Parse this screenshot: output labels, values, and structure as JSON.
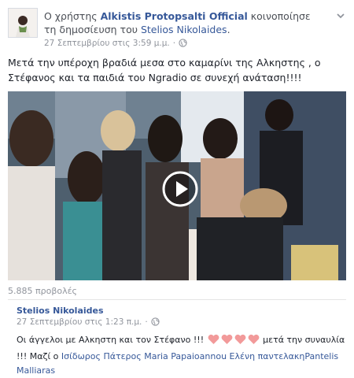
{
  "header": {
    "prefix": "Ο χρήστης ",
    "author": "Alkistis Protopsalti Official",
    "middle": " κοινοποίησε τη δημοσίευση του ",
    "shared_from": "Stelios Nikolaides",
    "suffix": ".",
    "timestamp": "27 Σεπτεμβρίου στις 3:59 μ.μ.",
    "separator": "·",
    "privacy_icon": "globe-icon",
    "options_icon": "chevron-down-icon"
  },
  "post": {
    "text": "Μετά την υπέροχη βραδιά μεσα στο καμαρίνι της Αλκηστης , ο Στέφανος και τα παιδιά του Ngradio σε συνεχή ανάταση!!!!",
    "video": {
      "play_icon": "play-icon"
    },
    "views": "5.885 προβολές"
  },
  "shared": {
    "author": "Stelios Nikolaides",
    "timestamp": "27 Σεπτεμβρίου στις 1:23 π.μ.",
    "separator": "·",
    "privacy_icon": "globe-icon",
    "text_before": "Οι άγγελοι με Αλκηστη και τον Στέφανο !!! ",
    "text_after": " μετά την συναυλία !!! Μαζί ο ",
    "tags": [
      "Ισίδωρος Πάτερος",
      "Maria Papaioannou",
      "Ελένη παντελακη",
      "Pantelis Malliaras"
    ],
    "heart_icon": "heart-icon",
    "heart_count": 4,
    "heart_color": "#f29a9a"
  },
  "colors": {
    "link": "#365899",
    "meta": "#90949c",
    "text": "#1d2129"
  }
}
